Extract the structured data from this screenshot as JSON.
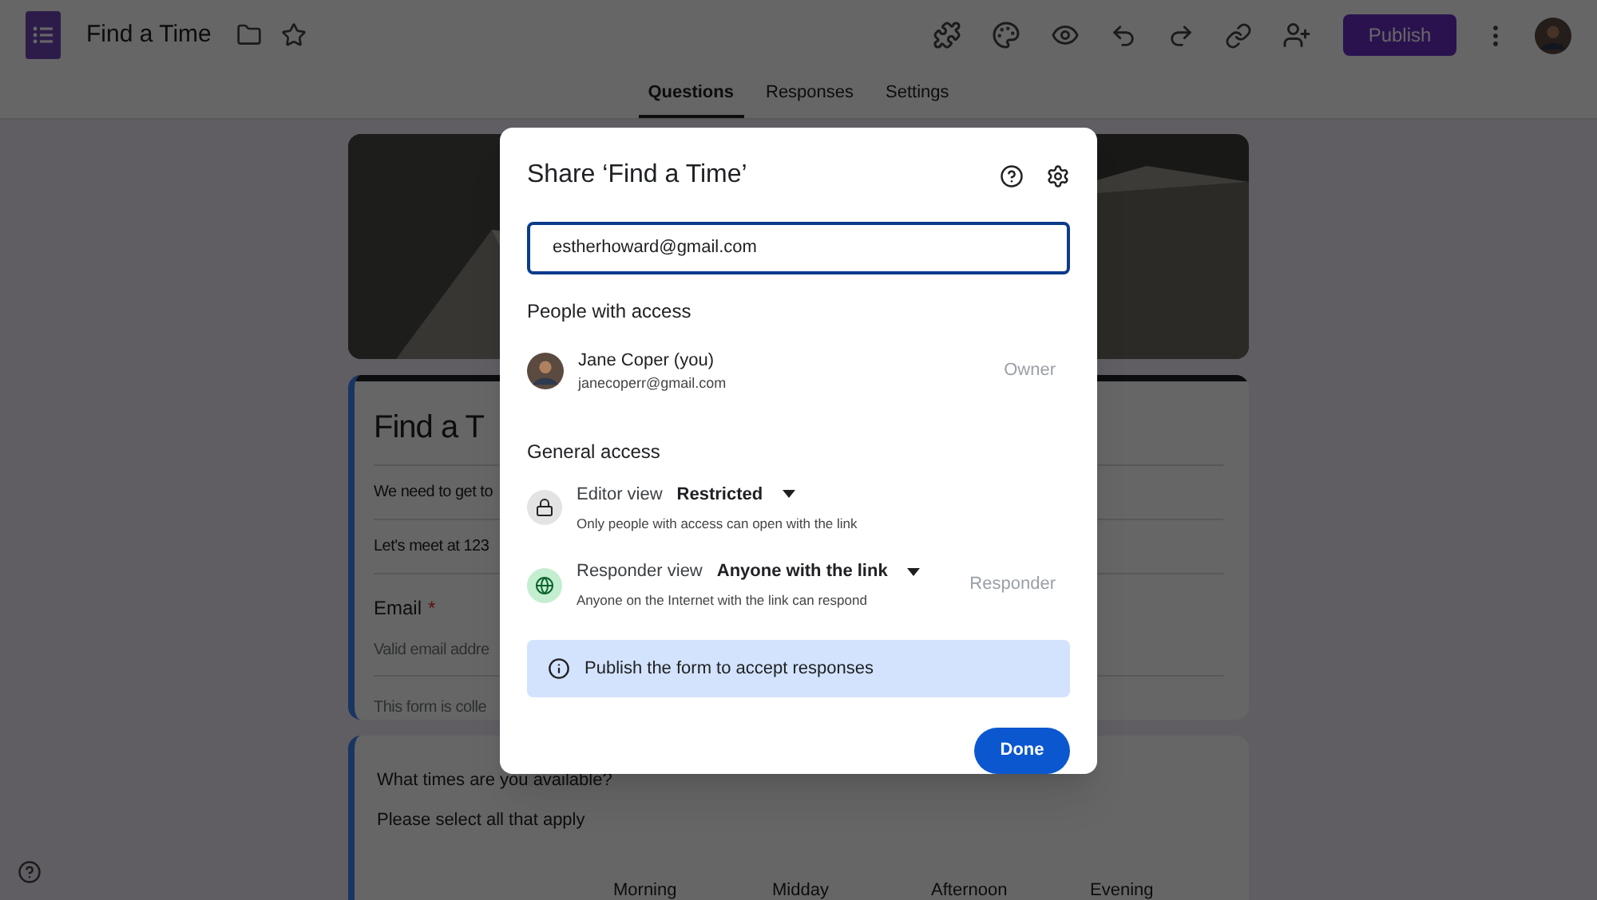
{
  "app": {
    "title": "Find a Time",
    "publish": "Publish"
  },
  "tabs": [
    {
      "label": "Questions",
      "selected": true
    },
    {
      "label": "Responses",
      "selected": false
    },
    {
      "label": "Settings",
      "selected": false
    }
  ],
  "form": {
    "title": "Find a T",
    "lines": [
      "We need to get to",
      "Let's meet at 123"
    ],
    "email_label": "Email",
    "required": "*",
    "email_placeholder": "Valid email addre",
    "note": "This form is colle"
  },
  "question": {
    "title": "What times are you available?",
    "subtitle": "Please select all that apply",
    "columns": [
      "Morning",
      "Midday",
      "Afternoon",
      "Evening"
    ]
  },
  "dialog": {
    "title": "Share ‘Find a Time’",
    "email_value": "estherhoward@gmail.com",
    "people_heading": "People with access",
    "people": [
      {
        "name": "Jane Coper (you)",
        "email": "janecoperr@gmail.com",
        "role": "Owner"
      }
    ],
    "general_heading": "General access",
    "access": [
      {
        "kind": "editor",
        "label": "Editor view",
        "value": "Restricted",
        "description": "Only people with access can open with the link"
      },
      {
        "kind": "responder",
        "label": "Responder view",
        "value": "Anyone with the link",
        "description": "Anyone on the Internet with the link can respond",
        "role": "Responder"
      }
    ],
    "banner": "Publish the form to accept responses",
    "done": "Done"
  }
}
